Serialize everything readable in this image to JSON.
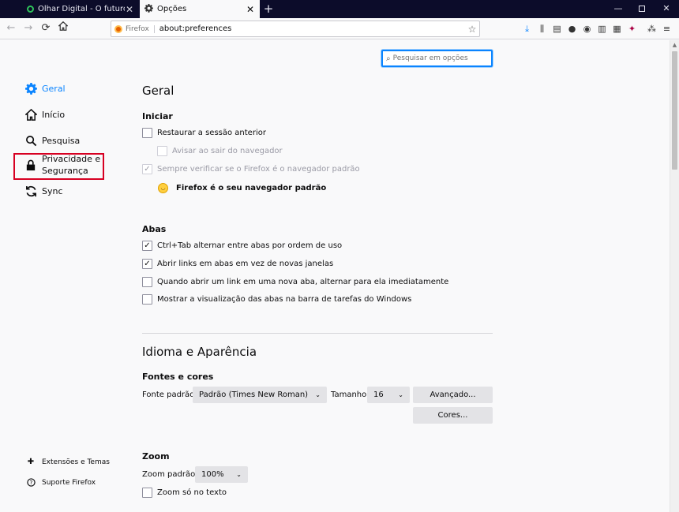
{
  "tabs": [
    {
      "title": "Olhar Digital - O futuro passa p",
      "active": false
    },
    {
      "title": "Opções",
      "active": true
    }
  ],
  "window_controls": {
    "minimize": "—",
    "close": "✕"
  },
  "navbar": {
    "identity": "Firefox",
    "url": "about:preferences"
  },
  "search": {
    "placeholder": "Pesquisar em opções"
  },
  "sidebar": {
    "items": [
      {
        "label": "Geral",
        "icon": "gear-icon",
        "selected": true
      },
      {
        "label": "Início",
        "icon": "home-icon"
      },
      {
        "label": "Pesquisa",
        "icon": "search-icon"
      },
      {
        "label": "Privacidade e",
        "label2": "Segurança",
        "icon": "lock-icon",
        "highlighted": true
      },
      {
        "label": "Sync",
        "icon": "sync-icon"
      }
    ],
    "footer": [
      {
        "label": "Extensões e Temas",
        "icon": "puzzle-icon"
      },
      {
        "label": "Suporte Firefox",
        "icon": "help-icon"
      }
    ]
  },
  "main": {
    "title": "Geral",
    "startup": {
      "heading": "Iniciar",
      "restore_session": {
        "label": "Restaurar a sessão anterior",
        "checked": false
      },
      "warn_on_quit": {
        "label": "Avisar ao sair do navegador",
        "checked": false,
        "disabled": true
      },
      "always_check_default": {
        "label": "Sempre verificar se o Firefox é o navegador padrão",
        "checked": true,
        "disabled": true
      },
      "default_status": "Firefox é o seu navegador padrão"
    },
    "tabs": {
      "heading": "Abas",
      "ctrl_tab": {
        "label": "Ctrl+Tab alternar entre abas por ordem de uso",
        "checked": true
      },
      "open_links_tabs": {
        "label": "Abrir links em abas em vez de novas janelas",
        "checked": true
      },
      "switch_to_new_tab": {
        "label": "Quando abrir um link em uma nova aba, alternar para ela imediatamente",
        "checked": false
      },
      "show_previews": {
        "label": "Mostrar a visualização das abas na barra de tarefas do Windows",
        "checked": false
      }
    },
    "language_appearance": {
      "heading": "Idioma e Aparência",
      "fonts_heading": "Fontes e cores",
      "default_font_label": "Fonte padrão",
      "default_font_value": "Padrão (Times New Roman)",
      "size_label": "Tamanho",
      "size_value": "16",
      "advanced_button": "Avançado...",
      "colors_button": "Cores..."
    },
    "zoom": {
      "heading": "Zoom",
      "default_zoom_label": "Zoom padrão",
      "default_zoom_value": "100%",
      "zoom_text_only": {
        "label": "Zoom só no texto",
        "checked": false
      }
    }
  },
  "colors": {
    "accent": "#0a84ff",
    "highlight_border": "#d70022"
  }
}
